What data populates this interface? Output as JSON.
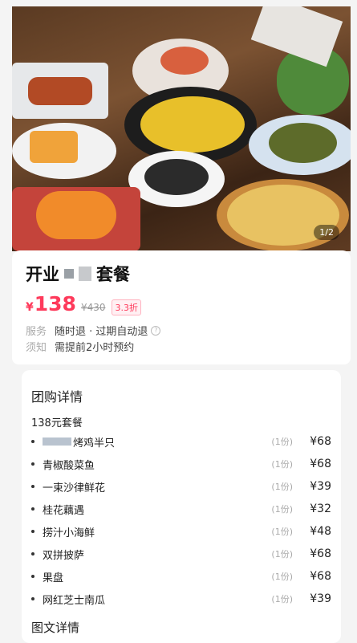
{
  "hero": {
    "pager": "1/2",
    "image_desc": "set meal photo"
  },
  "info": {
    "title_prefix": "开业",
    "title_suffix": "套餐",
    "currency": "¥",
    "price": "138",
    "original_price": "¥430",
    "discount": "3.3折",
    "service_label": "服务",
    "service_value": "随时退 · 过期自动退",
    "notice_label": "须知",
    "notice_value": "需提前2小时预约"
  },
  "detail": {
    "section_title": "团购详情",
    "set_title": "138元套餐",
    "items": [
      {
        "name": "烤鸡半只",
        "qty": "(1份)",
        "price": "¥68"
      },
      {
        "name": "青椒酸菜鱼",
        "qty": "(1份)",
        "price": "¥68"
      },
      {
        "name": "一束沙律鲜花",
        "qty": "(1份)",
        "price": "¥39"
      },
      {
        "name": "桂花藕遇",
        "qty": "(1份)",
        "price": "¥32"
      },
      {
        "name": "捞汁小海鲜",
        "qty": "(1份)",
        "price": "¥48"
      },
      {
        "name": "双拼披萨",
        "qty": "(1份)",
        "price": "¥68"
      },
      {
        "name": "果盘",
        "qty": "(1份)",
        "price": "¥68"
      },
      {
        "name": "网红芝士南瓜",
        "qty": "(1份)",
        "price": "¥39"
      }
    ],
    "more_title": "图文详情"
  }
}
